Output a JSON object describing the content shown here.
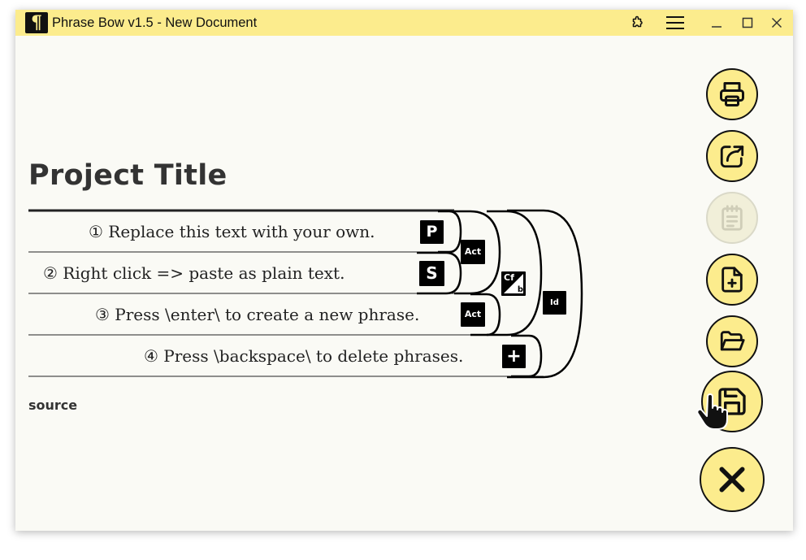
{
  "window": {
    "title": "Phrase Bow v1.5 - New Document",
    "app_icon_glyph": "¶"
  },
  "titlebar_buttons": [
    {
      "name": "puzzle-icon"
    },
    {
      "name": "menu-icon"
    },
    {
      "name": "minimize-icon"
    },
    {
      "name": "maximize-icon"
    },
    {
      "name": "close-icon"
    }
  ],
  "document": {
    "title": "Project Title",
    "source_label": "source"
  },
  "phrases": [
    {
      "text": "① Replace this text with your own.",
      "badge": "P"
    },
    {
      "text": "② Right click => paste as plain text.",
      "badge": "S"
    },
    {
      "text": "③ Press \\enter\\ to create a new phrase.",
      "badge": "Act"
    },
    {
      "text": "④ Press \\backspace\\ to delete phrases.",
      "badge": "+"
    }
  ],
  "bow_badges": {
    "act_1_2": "Act",
    "cf_top": "Cf",
    "cf_bottom": "b",
    "id": "Id"
  },
  "sidebar": [
    {
      "name": "print-icon",
      "disabled": false
    },
    {
      "name": "export-icon",
      "disabled": false
    },
    {
      "name": "notepad-icon",
      "disabled": true
    },
    {
      "name": "new-file-icon",
      "disabled": false
    },
    {
      "name": "open-folder-icon",
      "disabled": false
    },
    {
      "name": "save-icon",
      "disabled": false
    },
    {
      "name": "close-icon",
      "disabled": false
    }
  ],
  "colors": {
    "accent": "#fcec8d",
    "background": "#fafaf5",
    "ink": "#111111"
  }
}
